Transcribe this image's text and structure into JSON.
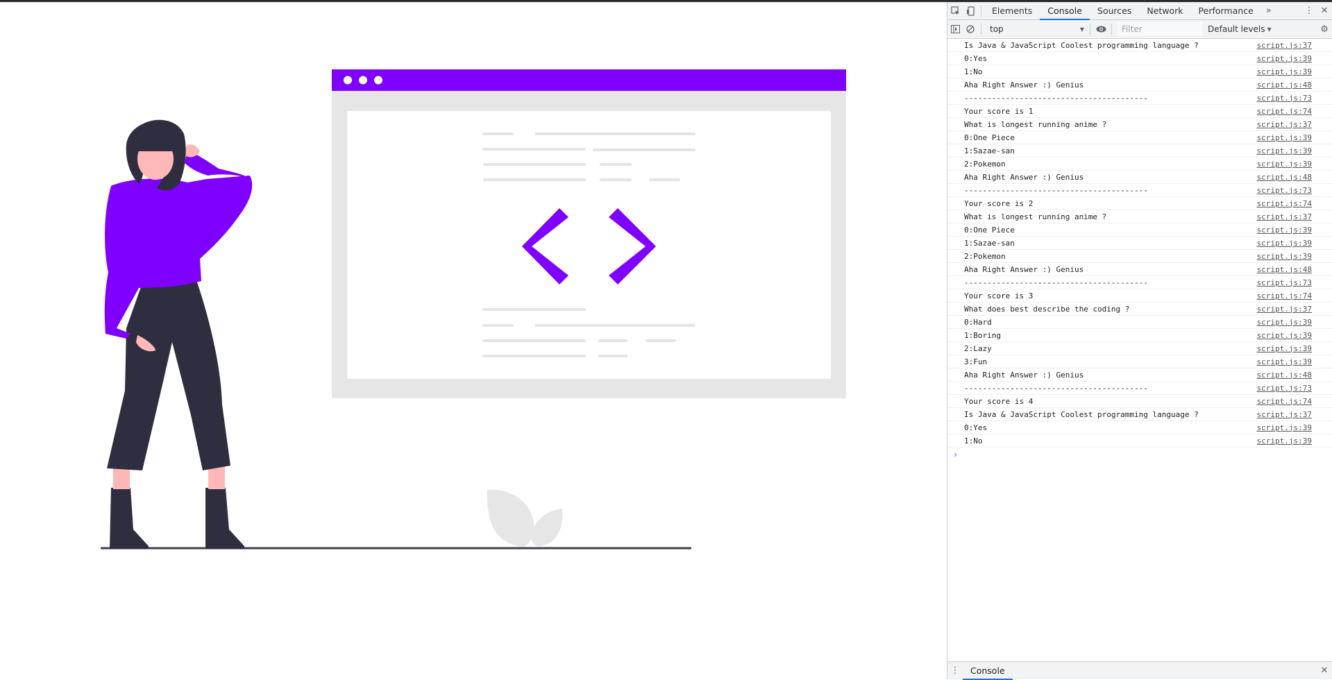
{
  "devtools": {
    "tabs": [
      {
        "label": "Elements"
      },
      {
        "label": "Console"
      },
      {
        "label": "Sources"
      },
      {
        "label": "Network"
      },
      {
        "label": "Performance"
      }
    ],
    "active_tab": "Console",
    "context_select": "top",
    "filter_placeholder": "Filter",
    "levels_label": "Default levels",
    "drawer_tab": "Console",
    "icons": [
      "inspect-icon",
      "device-toolbar-icon",
      "more-tabs-icon",
      "kebab-menu-icon",
      "close-icon",
      "sidebar-toggle-icon",
      "clear-console-icon",
      "eye-icon",
      "settings-gear-icon"
    ],
    "accent_color": "#1a73e8"
  },
  "console": {
    "messages": [
      {
        "text": "Is Java & JavaScript Coolest programming language ?",
        "source": "script.js:37"
      },
      {
        "text": "0:Yes",
        "source": "script.js:39"
      },
      {
        "text": "1:No",
        "source": "script.js:39"
      },
      {
        "text": "Aha Right Answer :) Genius",
        "source": "script.js:48"
      },
      {
        "text": "----------------------------------------",
        "source": "script.js:73"
      },
      {
        "text": "Your score is 1",
        "source": "script.js:74"
      },
      {
        "text": "What is longest running anime ?",
        "source": "script.js:37"
      },
      {
        "text": "0:One Piece",
        "source": "script.js:39"
      },
      {
        "text": "1:Sazae-san",
        "source": "script.js:39"
      },
      {
        "text": "2:Pokemon",
        "source": "script.js:39"
      },
      {
        "text": "Aha Right Answer :) Genius",
        "source": "script.js:48"
      },
      {
        "text": "----------------------------------------",
        "source": "script.js:73"
      },
      {
        "text": "Your score is 2",
        "source": "script.js:74"
      },
      {
        "text": "What is longest running anime ?",
        "source": "script.js:37"
      },
      {
        "text": "0:One Piece",
        "source": "script.js:39"
      },
      {
        "text": "1:Sazae-san",
        "source": "script.js:39"
      },
      {
        "text": "2:Pokemon",
        "source": "script.js:39"
      },
      {
        "text": "Aha Right Answer :) Genius",
        "source": "script.js:48"
      },
      {
        "text": "----------------------------------------",
        "source": "script.js:73"
      },
      {
        "text": "Your score is 3",
        "source": "script.js:74"
      },
      {
        "text": "What does best describe the coding ?",
        "source": "script.js:37"
      },
      {
        "text": "0:Hard",
        "source": "script.js:39"
      },
      {
        "text": "1:Boring",
        "source": "script.js:39"
      },
      {
        "text": "2:Lazy",
        "source": "script.js:39"
      },
      {
        "text": "3:Fun",
        "source": "script.js:39"
      },
      {
        "text": "Aha Right Answer :) Genius",
        "source": "script.js:48"
      },
      {
        "text": "----------------------------------------",
        "source": "script.js:73"
      },
      {
        "text": "Your score is 4",
        "source": "script.js:74"
      },
      {
        "text": "Is Java & JavaScript Coolest programming language ?",
        "source": "script.js:37"
      },
      {
        "text": "0:Yes",
        "source": "script.js:39"
      },
      {
        "text": "1:No",
        "source": "script.js:39"
      }
    ],
    "prompt_symbol": "›"
  },
  "illustration": {
    "accent_color": "#7f00ff",
    "description_icons": [
      "person-figure",
      "browser-window",
      "code-brackets-icon",
      "plant-leaves"
    ]
  }
}
